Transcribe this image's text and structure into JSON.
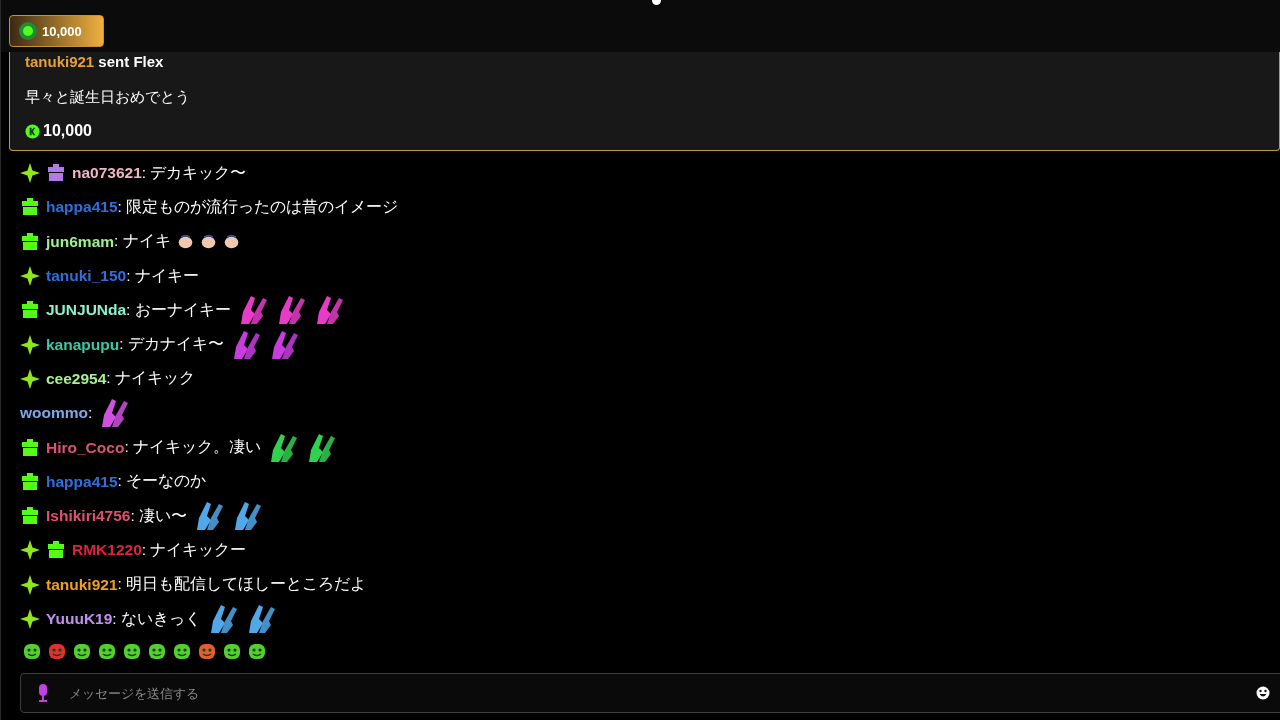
{
  "top_badge": {
    "amount": "10,000"
  },
  "pinned": {
    "user": "tanuki921",
    "action": "sent",
    "item": "Flex",
    "message": "早々と誕生日おめでとう",
    "amount": "10,000"
  },
  "messages": [
    {
      "badges": [
        {
          "kind": "sparkle"
        },
        {
          "kind": "gift",
          "color": "#b07be8"
        }
      ],
      "user": "na073621",
      "color": "#f0b4c8",
      "text": ": デカキック〜"
    },
    {
      "badges": [
        {
          "kind": "gift",
          "color": "#53fc18"
        }
      ],
      "user": "happa415",
      "color": "#2f6fdc",
      "text": ": 限定ものが流行ったのは昔のイメージ"
    },
    {
      "badges": [
        {
          "kind": "gift",
          "color": "#53fc18"
        }
      ],
      "user": "jun6mam",
      "color": "#a0f090",
      "text": ": ナイキ",
      "emotes": [
        {
          "kind": "clap",
          "color": "#f0c8b0"
        },
        {
          "kind": "clap",
          "color": "#f0c8b0"
        },
        {
          "kind": "clap",
          "color": "#f0c8b0"
        }
      ]
    },
    {
      "badges": [
        {
          "kind": "sparkle"
        }
      ],
      "user": "tanuki_150",
      "color": "#2f6fdc",
      "text": ": ナイキー"
    },
    {
      "badges": [
        {
          "kind": "gift",
          "color": "#53fc18"
        }
      ],
      "user": "JUNJUNda",
      "color": "#8ef0d0",
      "text": ": おーナイキー",
      "emotes": [
        {
          "kind": "hands",
          "color": "#e83cc8"
        },
        {
          "kind": "hands",
          "color": "#e83cc8"
        },
        {
          "kind": "hands",
          "color": "#e83cc8"
        }
      ]
    },
    {
      "badges": [
        {
          "kind": "sparkle"
        }
      ],
      "user": "kanapupu",
      "color": "#3cc8a8",
      "text": ": デカナイキ〜",
      "emotes": [
        {
          "kind": "hands",
          "color": "#c83ce0"
        },
        {
          "kind": "hands",
          "color": "#c83ce0"
        }
      ]
    },
    {
      "badges": [
        {
          "kind": "sparkle"
        }
      ],
      "user": "cee2954",
      "color": "#a8f090",
      "text": ": ナイキック"
    },
    {
      "user": "woommo",
      "color": "#7fa8e8",
      "text": ":",
      "emotes": [
        {
          "kind": "hands",
          "color": "#d050e0"
        }
      ]
    },
    {
      "badges": [
        {
          "kind": "gift",
          "color": "#53fc18"
        }
      ],
      "user": "Hiro_Coco",
      "color": "#e05070",
      "text": ": ナイキック。凄い",
      "emotes": [
        {
          "kind": "hands",
          "color": "#30d050"
        },
        {
          "kind": "hands",
          "color": "#30d050"
        }
      ]
    },
    {
      "badges": [
        {
          "kind": "gift",
          "color": "#53fc18"
        }
      ],
      "user": "happa415",
      "color": "#2f6fdc",
      "text": ": そーなのか"
    },
    {
      "badges": [
        {
          "kind": "gift",
          "color": "#53fc18"
        }
      ],
      "user": "Ishikiri4756",
      "color": "#e05070",
      "text": ": 凄い〜",
      "emotes": [
        {
          "kind": "hands",
          "color": "#50a8e8"
        },
        {
          "kind": "hands",
          "color": "#50a8e8"
        }
      ]
    },
    {
      "badges": [
        {
          "kind": "sparkle"
        },
        {
          "kind": "gift",
          "color": "#53fc18"
        }
      ],
      "user": "RMK1220",
      "color": "#e0203c",
      "text": ": ナイキックー"
    },
    {
      "badges": [
        {
          "kind": "sparkle"
        }
      ],
      "user": "tanuki921",
      "color": "#f0a020",
      "text": ": 明日も配信してほしーところだよ"
    },
    {
      "badges": [
        {
          "kind": "sparkle"
        }
      ],
      "user": "YuuuK19",
      "color": "#c090f0",
      "text": ": ないきっく",
      "emotes": [
        {
          "kind": "hands",
          "color": "#50a8e8"
        },
        {
          "kind": "hands",
          "color": "#50a8e8"
        }
      ]
    }
  ],
  "quick_emotes": [
    {
      "color": "#53d030"
    },
    {
      "color": "#e03030"
    },
    {
      "color": "#53d030"
    },
    {
      "color": "#53d030"
    },
    {
      "color": "#53d030"
    },
    {
      "color": "#53d030"
    },
    {
      "color": "#53d030"
    },
    {
      "color": "#e06030"
    },
    {
      "color": "#53d030"
    },
    {
      "color": "#53d030"
    }
  ],
  "input": {
    "placeholder": "メッセージを送信する"
  }
}
